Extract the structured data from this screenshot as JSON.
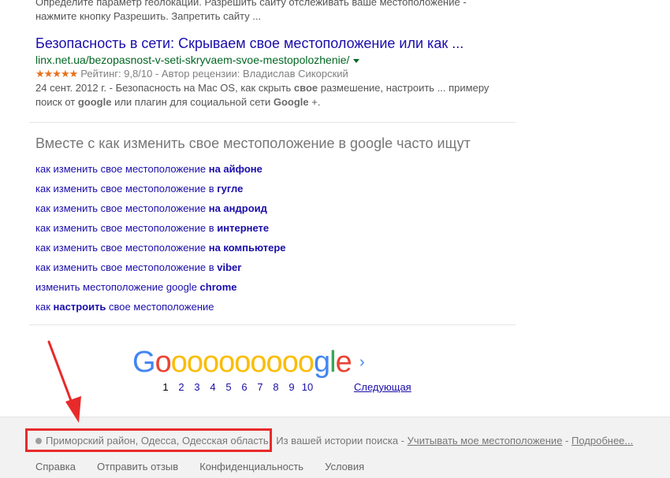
{
  "top_snippet": {
    "line1": "Определите параметр геолокации. Разрешить сайту отслеживать ваше местоположение -",
    "line2": "нажмите кнопку Разрешить. Запретить сайту ..."
  },
  "result": {
    "title": "Безопасность в сети: Скрываем свое местоположение или как ...",
    "url": "linx.net.ua/bezopasnost-v-seti-skryvaem-svoe-mestopolozhenie/",
    "stars": "★★★★★",
    "rating": "Рейтинг: 9,8/10 - Автор рецензии: Владислав Сикорский",
    "snippet_date": "24 сент. 2012 г. - ",
    "snippet_a": "Безопасность на Mac OS, как скрыть ",
    "snippet_b1": "свое",
    "snippet_c": " размешение, настроить ... примеру",
    "snippet_d": "поиск от ",
    "snippet_b2": "google",
    "snippet_e": " или плагин для социальной сети ",
    "snippet_b3": "Google",
    "snippet_f": " +."
  },
  "related": {
    "heading": "Вместе с как изменить свое местоположение в google часто ищут",
    "items": [
      {
        "plain": "как изменить свое местоположение ",
        "bold": "на айфоне",
        "after": ""
      },
      {
        "plain": "как изменить свое местоположение в ",
        "bold": "гугле",
        "after": ""
      },
      {
        "plain": "как изменить свое местоположение ",
        "bold": "на андроид",
        "after": ""
      },
      {
        "plain": "как изменить свое местоположение в ",
        "bold": "интернете",
        "after": ""
      },
      {
        "plain": "как изменить свое местоположение ",
        "bold": "на компьютере",
        "after": ""
      },
      {
        "plain": "как изменить свое местоположение в ",
        "bold": "viber",
        "after": ""
      },
      {
        "plain": "изменить местоположение google ",
        "bold": "chrome",
        "after": ""
      },
      {
        "plain": "как ",
        "bold": "настроить",
        "after": " свое местоположение"
      }
    ]
  },
  "pager": {
    "logo_letters": [
      "G",
      "o",
      "o",
      "o",
      "o",
      "o",
      "o",
      "o",
      "o",
      "o",
      "o",
      "g",
      "l",
      "e"
    ],
    "pages": [
      "1",
      "2",
      "3",
      "4",
      "5",
      "6",
      "7",
      "8",
      "9",
      "10"
    ],
    "current_page": "1",
    "next_label": "Следующая",
    "next_icon": "chevron-right-icon"
  },
  "footer": {
    "location": "Приморский район, Одесса, Одесская область",
    "source_text": "Из вашей истории поиска",
    "use_location": "Учитывать мое местоположение",
    "more": "Подробнее...",
    "separator": " - ",
    "links": [
      "Справка",
      "Отправить отзыв",
      "Конфиденциальность",
      "Условия"
    ]
  },
  "annotation": {
    "color": "#e82a2a"
  }
}
